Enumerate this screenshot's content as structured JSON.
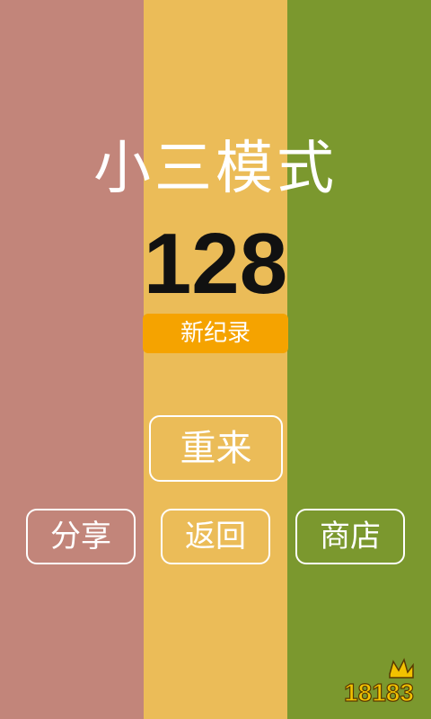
{
  "colors": {
    "column_left": "#c2857a",
    "column_middle": "#ebbc58",
    "column_right": "#7b982e",
    "badge": "#f5a300",
    "title_text": "#ffffff",
    "score_text": "#111111",
    "watermark": "#f2c200"
  },
  "game": {
    "mode_title": "小三模式",
    "score": "128",
    "record_badge": "新纪录"
  },
  "buttons": {
    "restart": "重来",
    "share": "分享",
    "back": "返回",
    "shop": "商店"
  },
  "watermark": {
    "text": "18183",
    "icon": "crown-icon"
  }
}
